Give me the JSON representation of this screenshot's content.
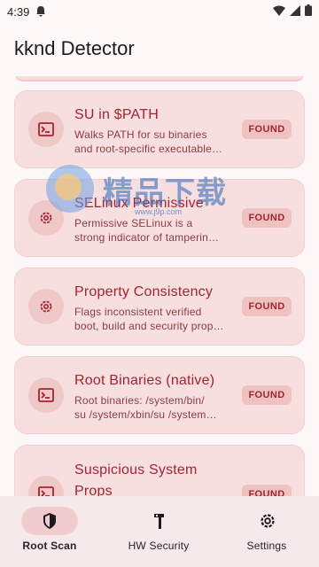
{
  "status_bar": {
    "time": "4:39",
    "icons": [
      "notification-icon",
      "wifi-icon",
      "signal-icon",
      "battery-icon"
    ]
  },
  "app": {
    "title": "kknd Detector"
  },
  "checks": [
    {
      "title": "SU in $PATH",
      "desc_lines": [
        "Walks PATH for su binaries",
        "and root-specific executable…"
      ],
      "status": "FOUND",
      "icon": "terminal-icon"
    },
    {
      "title": "SELinux Permissive",
      "desc_lines": [
        "Permissive SELinux is a",
        "strong indicator of tamperin…"
      ],
      "status": "FOUND",
      "icon": "gear-icon"
    },
    {
      "title": "Property Consistency",
      "desc_lines": [
        "Flags inconsistent verified",
        "boot, build and security prop…"
      ],
      "status": "FOUND",
      "icon": "gear-icon"
    },
    {
      "title": "Root Binaries (native)",
      "desc_lines": [
        "Root binaries: /system/bin/",
        "su /system/xbin/su /system…"
      ],
      "status": "FOUND",
      "icon": "terminal-icon"
    },
    {
      "title": "Suspicious System",
      "title2": "Props",
      "status": "FOUND",
      "icon": "terminal-icon"
    }
  ],
  "watermark": {
    "text": "精品下载",
    "url": "www.j9p.com"
  },
  "nav": {
    "items": [
      {
        "label": "Root Scan",
        "icon": "shield-icon",
        "active": true
      },
      {
        "label": "HW Security",
        "icon": "hammer-icon",
        "active": false
      },
      {
        "label": "Settings",
        "icon": "settings-icon",
        "active": false
      }
    ]
  },
  "colors": {
    "card_bg": "#f7dfdf",
    "accent": "#a3242f",
    "badge_bg": "#efc2c2",
    "nav_bg": "#f6e9e9",
    "nav_active_pill": "#f1cccf"
  }
}
